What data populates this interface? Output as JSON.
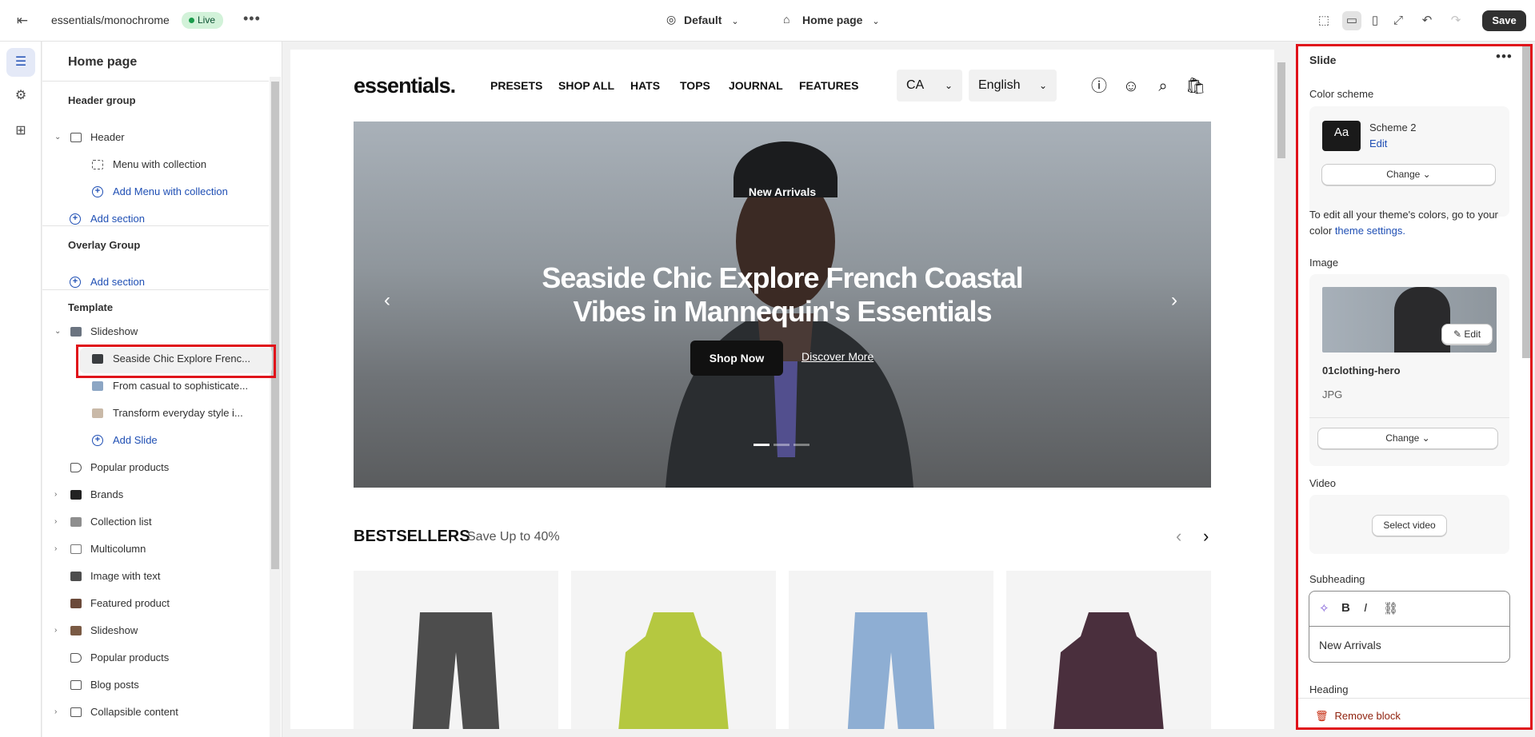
{
  "topbar": {
    "store": "essentials/monochrome",
    "live": "Live",
    "theme": "Default",
    "page": "Home page",
    "save": "Save"
  },
  "sidebar": {
    "title": "Home page",
    "header_group": "Header group",
    "header": "Header",
    "menu_with_collection": "Menu with collection",
    "add_menu_with_collection": "Add Menu with collection",
    "add_section_1": "Add section",
    "overlay_group": "Overlay Group",
    "add_section_2": "Add section",
    "template": "Template",
    "items": [
      {
        "label": "Slideshow"
      },
      {
        "label": "Seaside Chic Explore Frenc..."
      },
      {
        "label": "From casual to sophisticate..."
      },
      {
        "label": "Transform everyday style i..."
      },
      {
        "label": "Add Slide"
      },
      {
        "label": "Popular products"
      },
      {
        "label": "Brands"
      },
      {
        "label": "Collection list"
      },
      {
        "label": "Multicolumn"
      },
      {
        "label": "Image with text"
      },
      {
        "label": "Featured product"
      },
      {
        "label": "Slideshow"
      },
      {
        "label": "Popular products"
      },
      {
        "label": "Blog posts"
      },
      {
        "label": "Collapsible content"
      }
    ]
  },
  "preview": {
    "logo": "essentials.",
    "nav": [
      "PRESETS",
      "SHOP ALL",
      "HATS",
      "TOPS",
      "JOURNAL",
      "FEATURES"
    ],
    "country": "CA",
    "language": "English",
    "hero": {
      "eyebrow": "New Arrivals",
      "heading": "Seaside Chic Explore French Coastal Vibes in Mannequin's Essentials",
      "primary": "Shop Now",
      "secondary": "Discover More"
    },
    "bestsellers": "BESTSELLERS",
    "bestsellers_sub": "Save Up to 40%"
  },
  "panel": {
    "title": "Slide",
    "color_scheme_label": "Color scheme",
    "scheme_name": "Scheme 2",
    "scheme_swatch": "Aa",
    "edit": "Edit",
    "change": "Change",
    "help_text": "To edit all your theme's colors, go to your color",
    "help_link": "theme settings.",
    "image_label": "Image",
    "image_edit": "Edit",
    "image_name": "01clothing-hero",
    "image_type": "JPG",
    "image_change": "Change",
    "video_label": "Video",
    "select_video": "Select video",
    "subheading_label": "Subheading",
    "subheading_value": "New Arrivals",
    "heading_label": "Heading",
    "remove_block": "Remove block"
  },
  "colors": {
    "accent": "#1f4fb4",
    "highlight": "#e0121a",
    "live": "#d2f2d9"
  }
}
